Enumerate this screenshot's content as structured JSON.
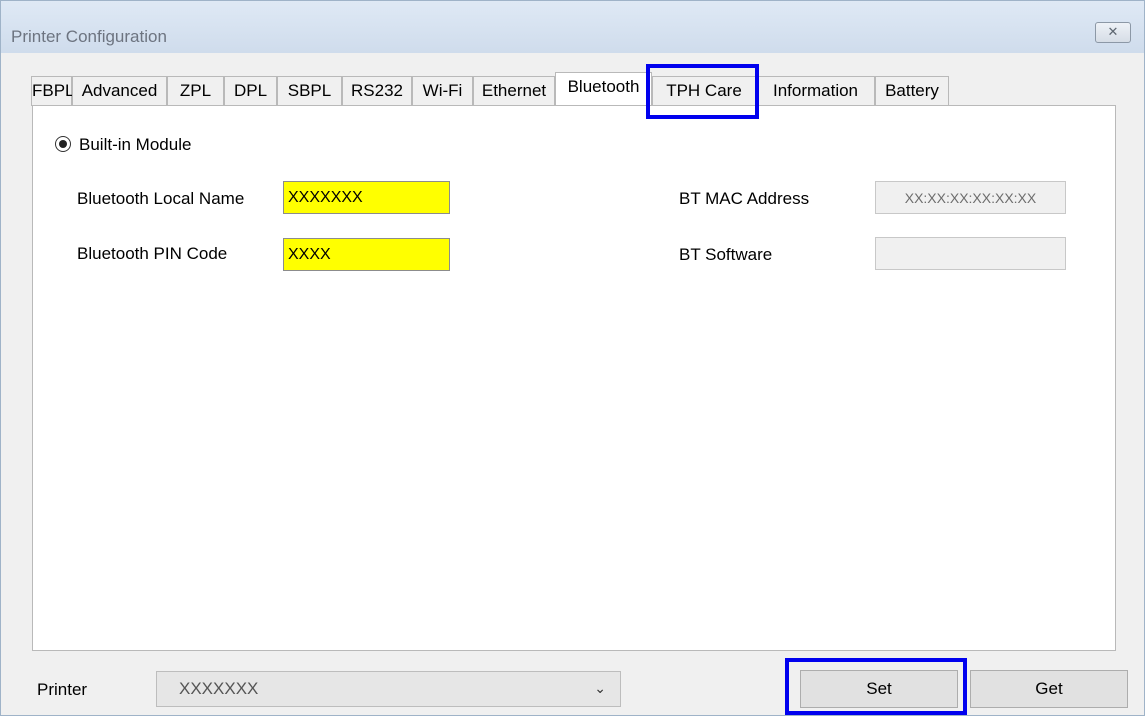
{
  "window": {
    "title": "Printer Configuration",
    "close_glyph": "✕"
  },
  "tabs": [
    {
      "label": "FBPL"
    },
    {
      "label": "Advanced"
    },
    {
      "label": "ZPL"
    },
    {
      "label": "DPL"
    },
    {
      "label": "SBPL"
    },
    {
      "label": "RS232"
    },
    {
      "label": "Wi-Fi"
    },
    {
      "label": "Ethernet"
    },
    {
      "label": "Bluetooth",
      "active": true
    },
    {
      "label": "TPH Care"
    },
    {
      "label": "Information"
    },
    {
      "label": "Battery"
    }
  ],
  "bluetooth": {
    "module_label": "Built-in Module",
    "module_selected": true,
    "local_name_label": "Bluetooth Local Name",
    "local_name_value": "XXXXXXX",
    "pin_label": "Bluetooth PIN Code",
    "pin_value": "XXXX",
    "mac_label": "BT MAC Address",
    "mac_value": "XX:XX:XX:XX:XX:XX",
    "software_label": "BT Software",
    "software_value": ""
  },
  "footer": {
    "printer_label": "Printer",
    "printer_value": "XXXXXXX",
    "set_label": "Set",
    "get_label": "Get"
  },
  "colors": {
    "highlight": "#0000ee",
    "field_highlight": "#ffff00"
  },
  "icons": {
    "close": "close-icon",
    "dropdown": "chevron-down-icon",
    "radio": "radio-selected-icon"
  }
}
